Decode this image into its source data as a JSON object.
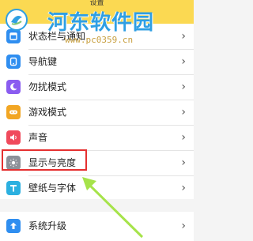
{
  "header": {
    "title": "设置"
  },
  "watermark": {
    "site_name": "河东软件园",
    "url": "www.pc0359.cn"
  },
  "settings": {
    "items": [
      {
        "label": "状态栏与通知",
        "icon": "status-bar-icon",
        "color": "#2f8ef0"
      },
      {
        "label": "导航键",
        "icon": "navigation-keys-icon",
        "color": "#2f8ef0"
      },
      {
        "label": "勿扰模式",
        "icon": "moon-icon",
        "color": "#8a5cf0"
      },
      {
        "label": "游戏模式",
        "icon": "gamepad-icon",
        "color": "#f2a623"
      },
      {
        "label": "声音",
        "icon": "speaker-icon",
        "color": "#f04a5c"
      },
      {
        "label": "显示与亮度",
        "icon": "brightness-icon",
        "color": "#8c9098"
      },
      {
        "label": "壁纸与字体",
        "icon": "font-t-icon",
        "color": "#2bb0e0"
      },
      {
        "label": "系统升级",
        "icon": "system-upgrade-icon",
        "color": "#2f8ef0"
      }
    ]
  },
  "colors": {
    "header_bg": "#fbd952",
    "highlight_border": "#e53030",
    "arrow": "#a6e34a"
  }
}
